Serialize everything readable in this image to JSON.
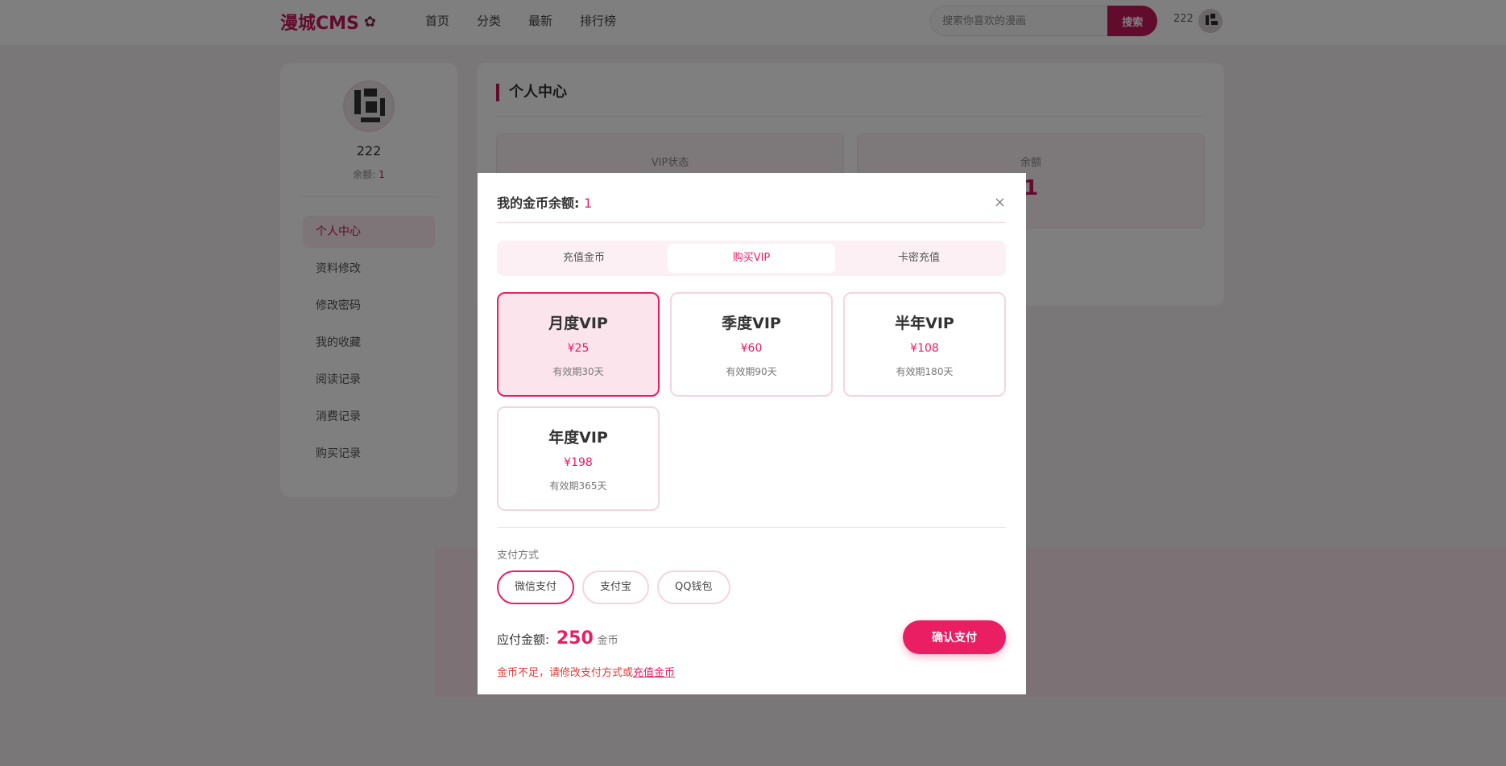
{
  "header": {
    "logo": "漫城CMS",
    "nav": [
      "首页",
      "分类",
      "最新",
      "排行榜"
    ],
    "search_placeholder": "搜索你喜欢的漫画",
    "search_button": "搜索",
    "username": "222"
  },
  "sidebar": {
    "username": "222",
    "balance_label": "余额:",
    "balance_value": "1",
    "menu": [
      "个人中心",
      "资料修改",
      "修改密码",
      "我的收藏",
      "阅读记录",
      "消费记录",
      "购买记录"
    ],
    "active_index": 0
  },
  "main": {
    "title": "个人中心",
    "stats": [
      {
        "label": "VIP状态",
        "value": ""
      },
      {
        "label": "余额",
        "value": "1"
      }
    ]
  },
  "modal": {
    "title": "我的金币余额:",
    "balance": "1",
    "close": "×",
    "tabs": [
      "充值金币",
      "购买VIP",
      "卡密充值"
    ],
    "active_tab": 1,
    "plans": [
      {
        "name": "月度VIP",
        "price": "¥25",
        "days": "有效期30天",
        "selected": true
      },
      {
        "name": "季度VIP",
        "price": "¥60",
        "days": "有效期90天",
        "selected": false
      },
      {
        "name": "半年VIP",
        "price": "¥108",
        "days": "有效期180天",
        "selected": false
      },
      {
        "name": "年度VIP",
        "price": "¥198",
        "days": "有效期365天",
        "selected": false
      }
    ],
    "payment_label": "支付方式",
    "payment_options": [
      "微信支付",
      "支付宝",
      "QQ钱包"
    ],
    "payment_selected": 0,
    "amount_label": "应付金额:",
    "amount_value": "250",
    "amount_unit": "金币",
    "confirm_button": "确认支付",
    "warning_text": "金币不足，请修改支付方式或",
    "warning_link": "充值金币"
  },
  "colors": {
    "accent": "#e91e63",
    "brand": "#c2185b"
  }
}
